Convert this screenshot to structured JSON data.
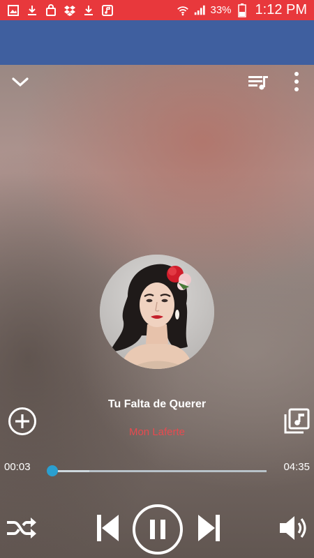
{
  "status_bar": {
    "battery_percent": "33%",
    "time": "1:12 PM",
    "notification_icons": [
      "gallery-icon",
      "download-icon",
      "shopping-bag-icon",
      "dropbox-icon",
      "download-icon",
      "music-note-icon"
    ],
    "bar_color": "#e8383c"
  },
  "app_bar": {
    "color": "#3f5f9f"
  },
  "track": {
    "title": "Tu Falta de Querer",
    "artist": "Mon Laferte"
  },
  "progress": {
    "elapsed": "00:03",
    "total": "04:35",
    "fraction": 0.011,
    "buffered_fraction": 0.18
  },
  "colors": {
    "accent": "#2a9fd0",
    "artist": "#e84a4f"
  }
}
